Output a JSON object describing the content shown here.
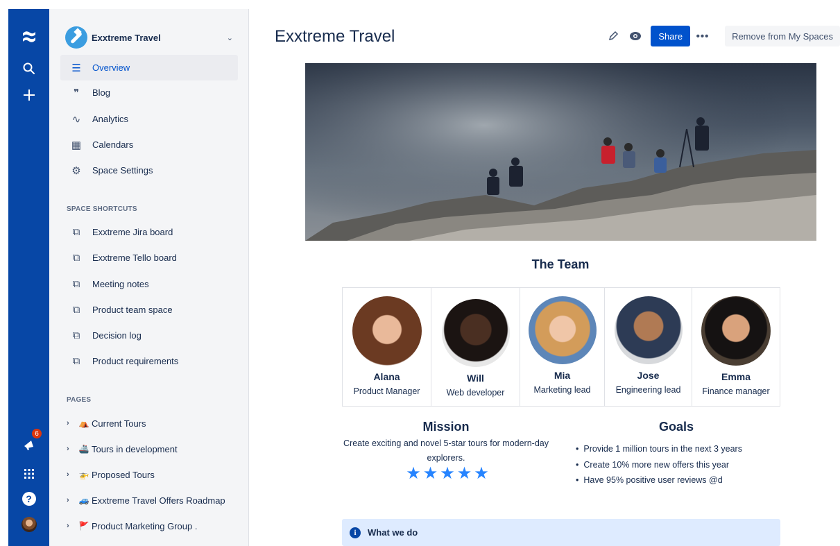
{
  "global_nav": {
    "logo_icon": "confluence-logo-icon",
    "search_icon": "search-icon",
    "create_icon": "plus-icon",
    "notifications_count": "6",
    "apps_icon": "app-switcher-icon",
    "help_glyph": "?"
  },
  "space": {
    "name": "Exxtreme Travel",
    "logo_icon": "space-logo-icon"
  },
  "sidebar": {
    "items": [
      {
        "label": "Overview",
        "icon": "overview-icon",
        "glyph": "☰"
      },
      {
        "label": "Blog",
        "icon": "quote-icon",
        "glyph": "❞"
      },
      {
        "label": "Analytics",
        "icon": "analytics-icon",
        "glyph": "∿"
      },
      {
        "label": "Calendars",
        "icon": "calendar-icon",
        "glyph": "▦"
      },
      {
        "label": "Space Settings",
        "icon": "gear-icon",
        "glyph": "⚙"
      }
    ],
    "shortcuts_title": "SPACE SHORTCUTS",
    "shortcuts": [
      {
        "label": "Exxtreme Jira board"
      },
      {
        "label": "Exxtreme Tello board"
      },
      {
        "label": "Meeting notes"
      },
      {
        "label": "Product team space"
      },
      {
        "label": "Decision log"
      },
      {
        "label": "Product requirements"
      }
    ],
    "shortcut_glyph": "⧉",
    "pages_title": "PAGES",
    "pages": [
      {
        "label": "Current Tours",
        "emoji": "⛺"
      },
      {
        "label": "Tours in development",
        "emoji": "🚢"
      },
      {
        "label": "Proposed Tours",
        "emoji": "🚁"
      },
      {
        "label": "Exxtreme Travel Offers Roadmap",
        "emoji": "🚙"
      },
      {
        "label": "Product Marketing Group .",
        "emoji": "🚩"
      }
    ],
    "page_chevron": "›"
  },
  "page": {
    "title": "Exxtreme Travel",
    "toolbar": {
      "edit_glyph": "✎",
      "watch_glyph": "◉",
      "share_label": "Share",
      "more_glyph": "•••",
      "remove_label": "Remove from My Spaces"
    },
    "team_heading": "The Team",
    "team": [
      {
        "name": "Alana",
        "role": "Product Manager"
      },
      {
        "name": "Will",
        "role": "Web developer"
      },
      {
        "name": "Mia",
        "role": "Marketing lead"
      },
      {
        "name": "Jose",
        "role": "Engineering lead"
      },
      {
        "name": "Emma",
        "role": "Finance manager"
      }
    ],
    "mission_title": "Mission",
    "mission_text": "Create exciting and novel 5-star tours for modern-day explorers.",
    "stars": 5,
    "star_glyph": "★",
    "goals_title": "Goals",
    "goals": [
      "Provide 1 million tours in the next 3 years",
      "Create 10% more new offers this year",
      "Have 95% positive user reviews @d"
    ],
    "info_glyph": "i",
    "info_title": "What we do"
  },
  "colors": {
    "global_nav": "#0747A6",
    "sidebar_bg": "#F4F5F7",
    "primary": "#0052CC",
    "star": "#2684FF",
    "info_panel": "#DEEBFF"
  }
}
